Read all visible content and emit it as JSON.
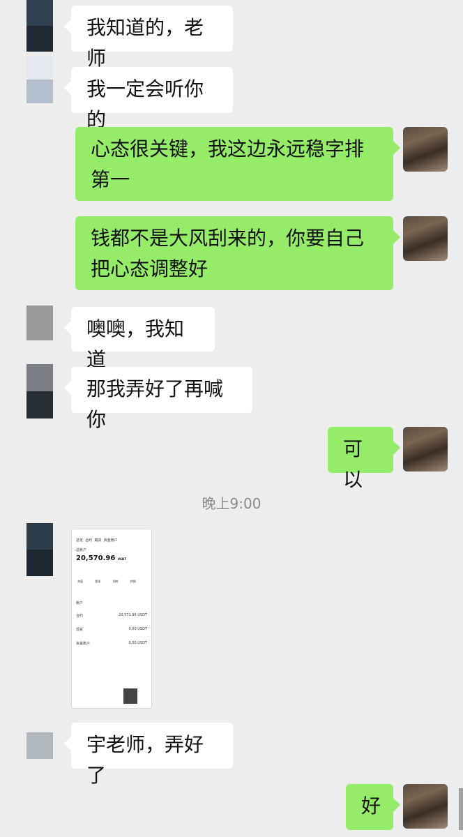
{
  "messages": [
    {
      "side": "left",
      "text": "我知道的，老师"
    },
    {
      "side": "left",
      "text": "我一定会听你的"
    },
    {
      "side": "right",
      "text": "心态很关键，我这边永远稳字排第一"
    },
    {
      "side": "right",
      "text": "钱都不是大风刮来的，你要自己把心态调整好"
    },
    {
      "side": "left",
      "text": "噢噢，我知道"
    },
    {
      "side": "left",
      "text": "那我弄好了再喊你"
    },
    {
      "side": "right",
      "text": "可以"
    },
    {
      "side": "left",
      "text": "宇老师，弄好了"
    },
    {
      "side": "right",
      "text": "好"
    }
  ],
  "timestamp": "晚上9:00",
  "screenshot_thumb": {
    "tabs": [
      "总览",
      "合约",
      "期货",
      "资金账户"
    ],
    "balance_label": "总账户",
    "balance": "20,570.96",
    "balance_unit": "USDT",
    "actions": [
      "充值",
      "提现",
      "划转",
      "转换"
    ],
    "section": "账户",
    "rows": [
      {
        "label": "合约",
        "value": "20,571.96 USDT"
      },
      {
        "label": "现货",
        "value": "0.00 USDT"
      },
      {
        "label": "资金账户",
        "value": "0.00 USDT"
      }
    ]
  },
  "colors": {
    "background": "#ededed",
    "left_bubble": "#ffffff",
    "right_bubble": "#95ec69"
  }
}
